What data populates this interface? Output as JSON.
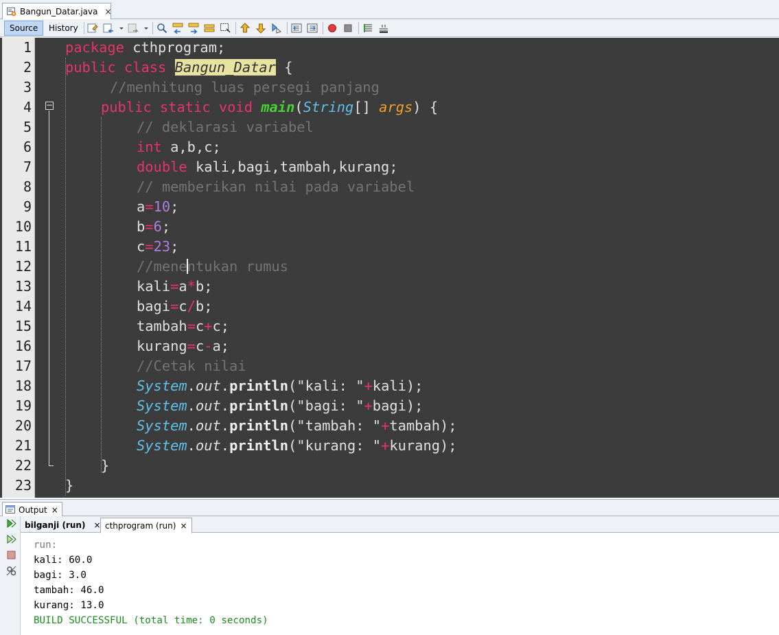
{
  "file_tab": {
    "label": "Bangun_Datar.java",
    "close": "×"
  },
  "toolbar": {
    "source_label": "Source",
    "history_label": "History",
    "icons": [
      "last-edit-icon",
      "back-icon",
      "forward-icon",
      "find-icon",
      "find-previous-icon",
      "find-next-icon",
      "toggle-highlight-icon",
      "toggle-rectangular-selection-icon",
      "previous-bookmark-icon",
      "next-bookmark-icon",
      "toggle-bookmark-icon",
      "shift-left-icon",
      "shift-right-icon",
      "start-macro-icon",
      "stop-macro-icon",
      "comment-icon",
      "uncomment-icon"
    ]
  },
  "editor": {
    "line_numbers": [
      "1",
      "2",
      "3",
      "4",
      "5",
      "6",
      "7",
      "8",
      "9",
      "10",
      "11",
      "12",
      "13",
      "14",
      "15",
      "16",
      "17",
      "18",
      "19",
      "20",
      "21",
      "22",
      "23"
    ],
    "fold_marker": "−",
    "lines": {
      "l1": {
        "kw": "package",
        "rest": " cthprogram;"
      },
      "l2": {
        "kw": "public class",
        "cls": "Bangun_Datar",
        "rest": " {"
      },
      "l3": {
        "cm": "//menhitung luas persegi panjang"
      },
      "l4": {
        "kw": "public static void",
        "meth": "main",
        "p1": "(",
        "type": "String",
        "p2": "[] ",
        "param": "args",
        "p3": ") {"
      },
      "l5": {
        "cm": "// deklarasi variabel"
      },
      "l6": {
        "kw": "int",
        "rest": " a,b,c;"
      },
      "l7": {
        "kw": "double",
        "rest": " kali,bagi,tambah,kurang;"
      },
      "l8": {
        "cm": "// memberikan nilai pada variabel"
      },
      "l9": {
        "var": "a",
        "op": "=",
        "num": "10",
        "end": ";"
      },
      "l10": {
        "var": "b",
        "op": "=",
        "num": "6",
        "end": ";"
      },
      "l11": {
        "var": "c",
        "op": "=",
        "num": "23",
        "end": ";"
      },
      "l12": {
        "cm_a": "//mene",
        "cm_b": "ntukan rumus"
      },
      "l13": {
        "a": "kali",
        "op1": "=",
        "b": "a",
        "op2": "*",
        "c": "b;"
      },
      "l14": {
        "a": "bagi",
        "op1": "=",
        "b": "c",
        "op2": "/",
        "c": "b;"
      },
      "l15": {
        "a": "tambah",
        "op1": "=",
        "b": "c",
        "op2": "+",
        "c": "c;"
      },
      "l16": {
        "a": "kurang",
        "op1": "=",
        "b": "c",
        "op2": "-",
        "c": "a;"
      },
      "l17": {
        "cm": "//Cetak nilai"
      },
      "l18": {
        "sys": "System",
        "dot1": ".",
        "out": "out",
        "dot2": ".",
        "pr": "println",
        "s": "(\"kali: \"",
        "plus": "+",
        "v": "kali);"
      },
      "l19": {
        "sys": "System",
        "dot1": ".",
        "out": "out",
        "dot2": ".",
        "pr": "println",
        "s": "(\"bagi: \"",
        "plus": "+",
        "v": "bagi);"
      },
      "l20": {
        "sys": "System",
        "dot1": ".",
        "out": "out",
        "dot2": ".",
        "pr": "println",
        "s": "(\"tambah: \"",
        "plus": "+",
        "v": "tambah);"
      },
      "l21": {
        "sys": "System",
        "dot1": ".",
        "out": "out",
        "dot2": ".",
        "pr": "println",
        "s": "(\"kurang: \"",
        "plus": "+",
        "v": "kurang);"
      },
      "l22": {
        "rest": "}"
      },
      "l23": {
        "rest": "}"
      }
    }
  },
  "output": {
    "title": "Output",
    "close": "×",
    "run_tabs": [
      {
        "label": "bilganji (run)",
        "close": "×"
      },
      {
        "label": "cthprogram (run)",
        "close": "×"
      }
    ],
    "console": [
      "run:",
      "kali: 60.0",
      "bagi: 3.0",
      "tambah: 46.0",
      "kurang: 13.0",
      "BUILD SUCCESSFUL (total time: 0 seconds)"
    ]
  },
  "colors": {
    "editor_bg": "#3c3c3c",
    "keyword": "#e8336c",
    "comment": "#747474",
    "number": "#b07ee0",
    "method": "#4ad035",
    "type": "#61c0e8",
    "param": "#f0a028",
    "build_success": "#1c8a1c"
  }
}
